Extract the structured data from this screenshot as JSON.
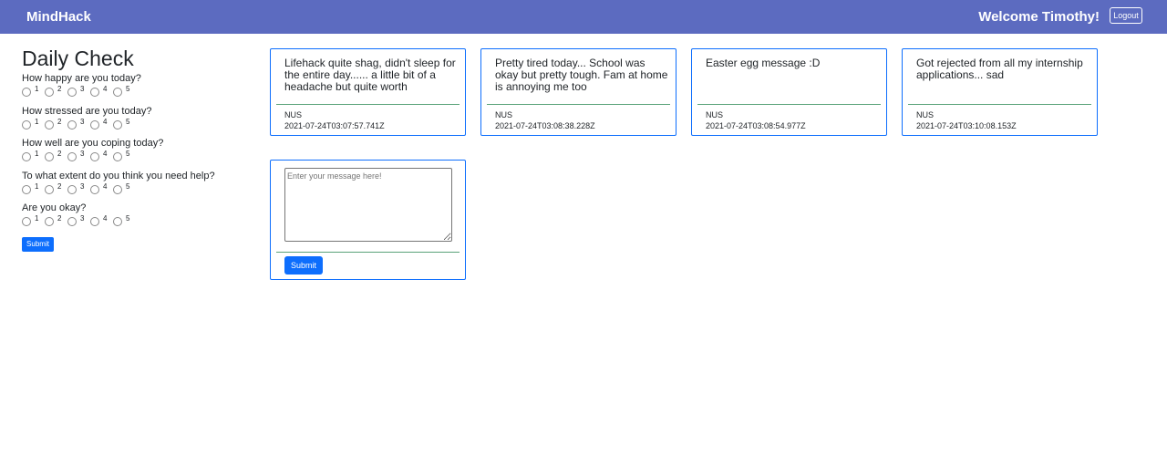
{
  "navbar": {
    "brand": "MindHack",
    "welcome": "Welcome Timothy!",
    "logout_label": "Logout"
  },
  "daily_check": {
    "title": "Daily Check",
    "options": [
      "1",
      "2",
      "3",
      "4",
      "5"
    ],
    "questions": [
      {
        "label": "How happy are you today?"
      },
      {
        "label": "How stressed are you today?"
      },
      {
        "label": "How well are you coping today?"
      },
      {
        "label": "To what extent do you think you need help?"
      },
      {
        "label": "Are you okay?"
      }
    ],
    "submit_label": "Submit"
  },
  "messages": [
    {
      "text": "Lifehack quite shag, didn't sleep for the entire day...... a little bit of a headache but quite worth",
      "org": "NUS",
      "timestamp": "2021-07-24T03:07:57.741Z"
    },
    {
      "text": "Pretty tired today... School was okay but pretty tough. Fam at home is annoying me too",
      "org": "NUS",
      "timestamp": "2021-07-24T03:08:38.228Z"
    },
    {
      "text": "Easter egg message :D",
      "org": "NUS",
      "timestamp": "2021-07-24T03:08:54.977Z"
    },
    {
      "text": "Got rejected from all my internship applications... sad",
      "org": "NUS",
      "timestamp": "2021-07-24T03:10:08.153Z"
    }
  ],
  "compose": {
    "placeholder": "Enter your message here!",
    "value": "",
    "submit_label": "Submit"
  },
  "colors": {
    "navbar": "#5c6bc0",
    "primary": "#0d6efd",
    "divider": "#5aa37a"
  }
}
